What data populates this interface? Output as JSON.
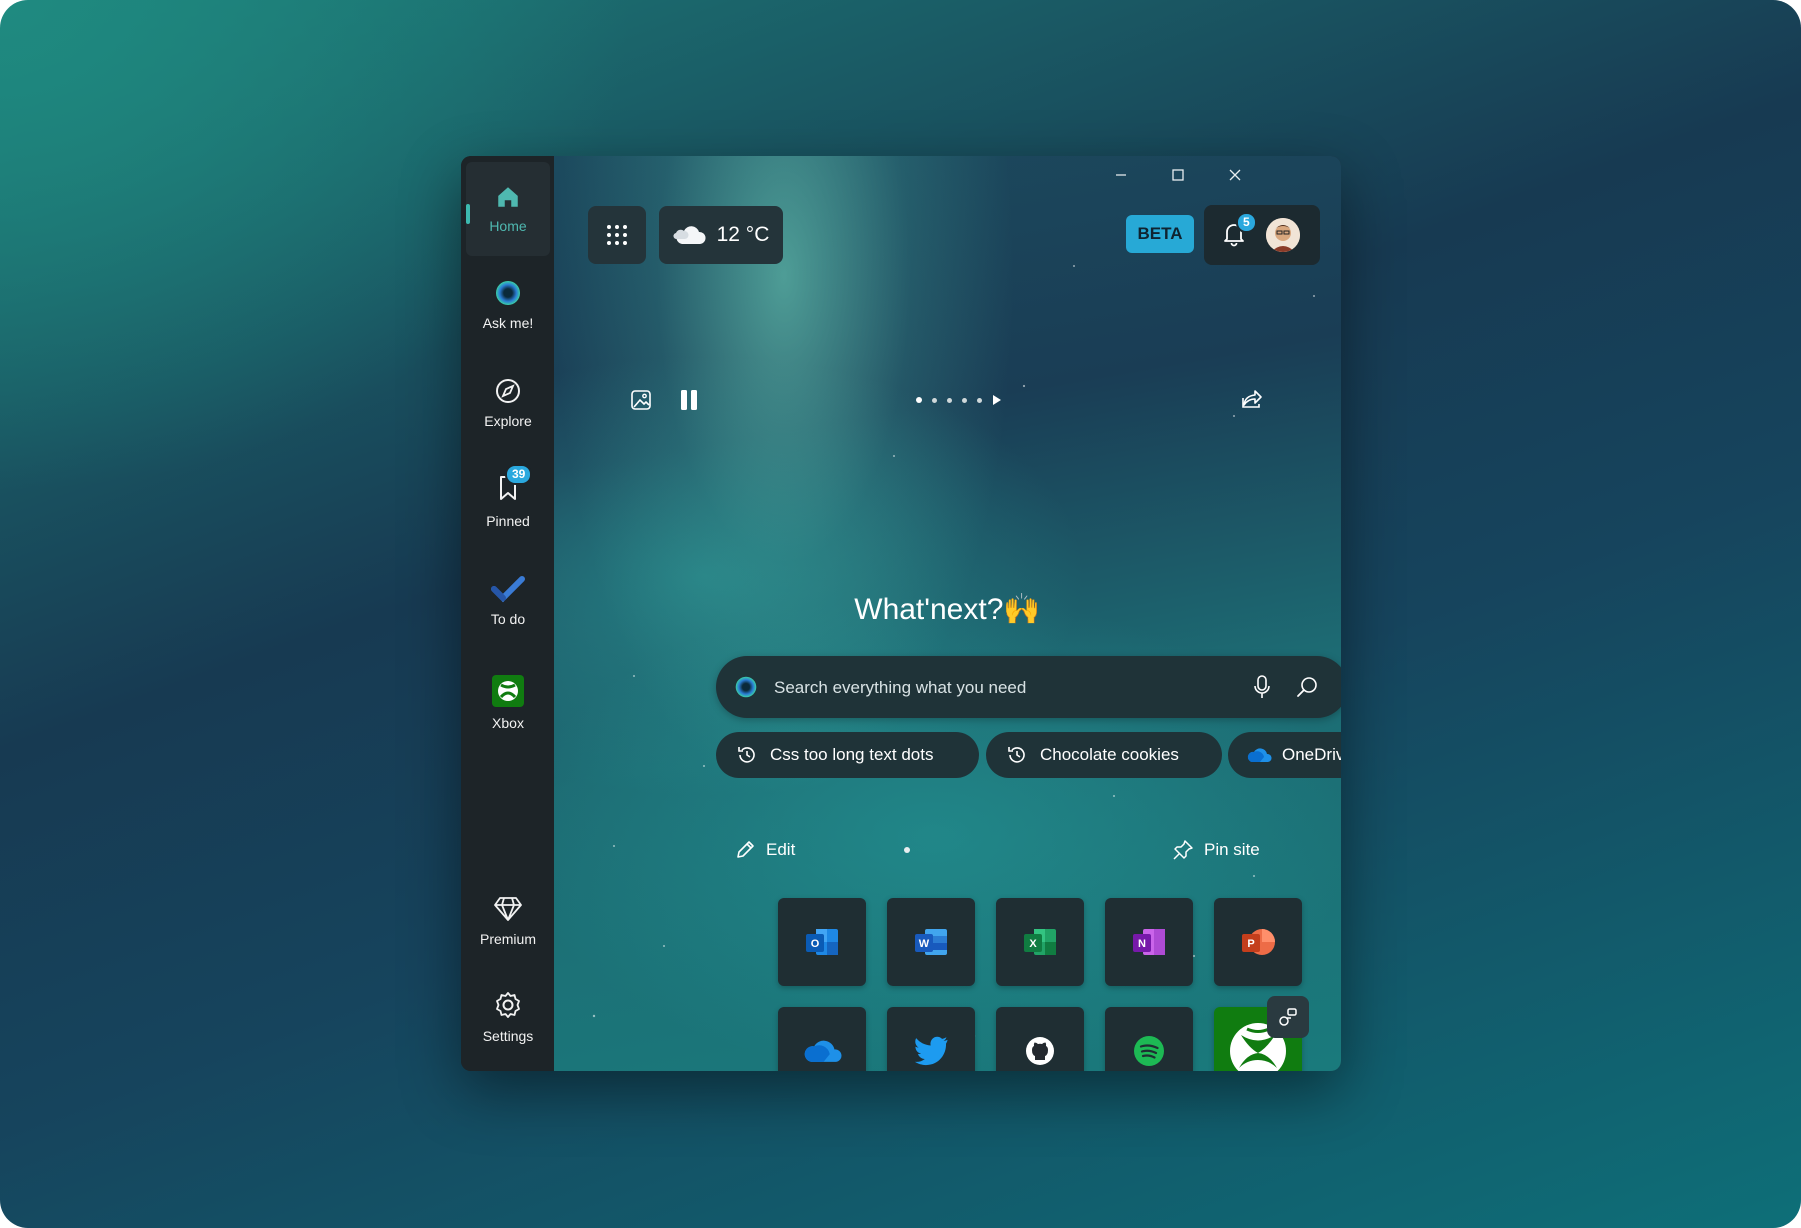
{
  "sidebar": {
    "items": [
      {
        "id": "home",
        "label": "Home"
      },
      {
        "id": "ask",
        "label": "Ask me!"
      },
      {
        "id": "explore",
        "label": "Explore"
      },
      {
        "id": "pinned",
        "label": "Pinned",
        "badge": "39"
      },
      {
        "id": "todo",
        "label": "To do"
      },
      {
        "id": "xbox",
        "label": "Xbox"
      },
      {
        "id": "premium",
        "label": "Premium"
      },
      {
        "id": "settings",
        "label": "Settings"
      }
    ]
  },
  "toolbar": {
    "weather": "12 °C",
    "beta": "BETA",
    "notifications": "5"
  },
  "hero": {
    "headline": "What'next?🙌"
  },
  "search": {
    "placeholder": "Search everything what you need"
  },
  "chips": [
    {
      "label": "Css too long text dots",
      "icon": "history-icon"
    },
    {
      "label": "Chocolate cookies",
      "icon": "history-icon"
    },
    {
      "label": "OneDrive",
      "icon": "onedrive-icon"
    }
  ],
  "actions": {
    "edit": "Edit",
    "pin_site": "Pin site"
  },
  "tiles": [
    {
      "name": "outlook"
    },
    {
      "name": "word"
    },
    {
      "name": "excel"
    },
    {
      "name": "onenote"
    },
    {
      "name": "powerpoint"
    },
    {
      "name": "onedrive"
    },
    {
      "name": "twitter"
    },
    {
      "name": "github"
    },
    {
      "name": "spotify"
    },
    {
      "name": "xbox"
    }
  ],
  "colors": {
    "accent": "#2aa8de",
    "active": "#4fb8b0",
    "xbox": "#107c10"
  }
}
